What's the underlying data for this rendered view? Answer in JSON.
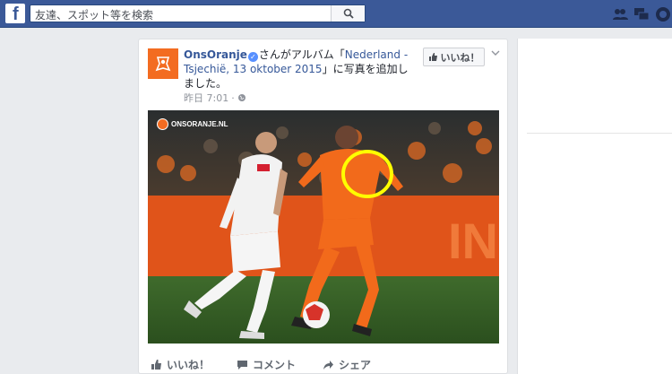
{
  "search": {
    "placeholder": "友達、スポット等を検索"
  },
  "post": {
    "page_name": "OnsOranje",
    "header_mid": "さんがアルバム「",
    "album_name": "Nederland - Tsjechië, 13 oktober 2015",
    "header_end": "」に写真を追加しました。",
    "timestamp": "昨日 7:01",
    "like_page_label": "いいね！",
    "watermark": "ONSORANJE.NL",
    "actions": {
      "like": "いいね！",
      "comment": "コメント",
      "share": "シェア"
    }
  },
  "colors": {
    "topbar": "#3b5998",
    "brand_orange": "#f36c21",
    "link": "#365899",
    "highlight_circle": "#ffff00"
  }
}
